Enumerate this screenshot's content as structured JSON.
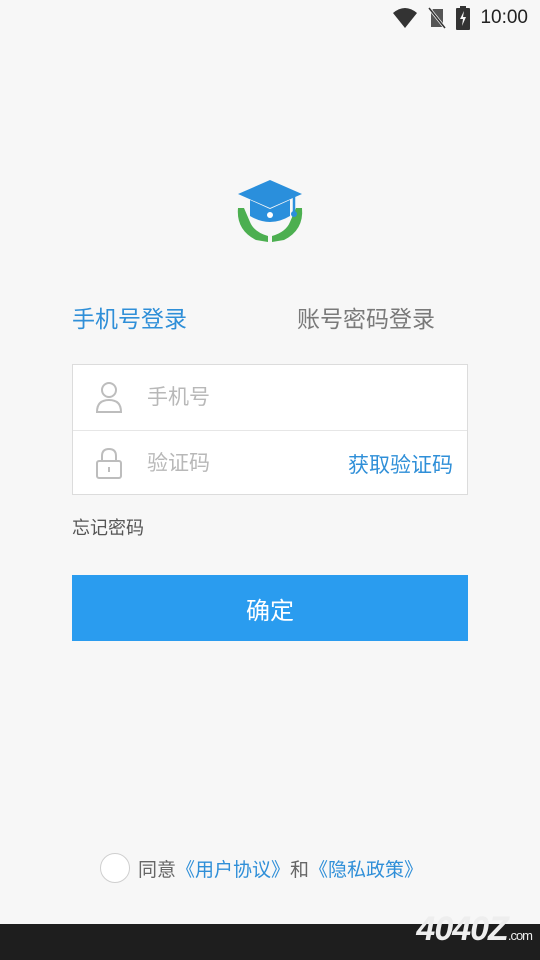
{
  "status_bar": {
    "time": "10:00",
    "icons": [
      "wifi-icon",
      "no-sim-icon",
      "battery-charging-icon"
    ]
  },
  "logo": {
    "icon": "graduation-cap-hands-icon",
    "colors": {
      "cap": "#2a8fdc",
      "hands": "#4caf50"
    }
  },
  "tabs": [
    {
      "label": "手机号登录",
      "active": true
    },
    {
      "label": "账号密码登录",
      "active": false
    }
  ],
  "form": {
    "phone": {
      "placeholder": "手机号",
      "value": "",
      "icon": "user-icon"
    },
    "code": {
      "placeholder": "验证码",
      "value": "",
      "icon": "lock-icon"
    },
    "get_code_label": "获取验证码"
  },
  "forgot_password": "忘记密码",
  "confirm_label": "确定",
  "agreement": {
    "prefix": "同意",
    "user_agreement": "《用户协议》",
    "and": "和",
    "privacy_policy": "《隐私政策》",
    "checked": false
  },
  "watermark": {
    "text": "4040Z",
    "suffix": ".com"
  },
  "colors": {
    "accent": "#2a9cef",
    "link": "#2f8fd8",
    "background": "#f7f7f7"
  }
}
